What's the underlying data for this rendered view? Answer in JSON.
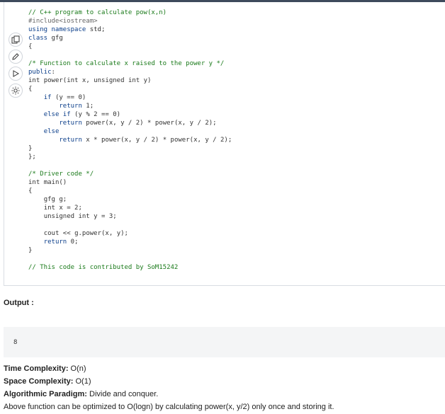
{
  "code": {
    "lines": [
      "// C++ program to calculate pow(x,n)",
      "#include<iostream>",
      "using namespace std;",
      "class gfg",
      "{",
      "",
      "/* Function to calculate x raised to the power y */",
      "public:",
      "int power(int x, unsigned int y)",
      "{",
      "    if (y == 0)",
      "        return 1;",
      "    else if (y % 2 == 0)",
      "        return power(x, y / 2) * power(x, y / 2);",
      "    else",
      "        return x * power(x, y / 2) * power(x, y / 2);",
      "}",
      "};",
      "",
      "/* Driver code */",
      "int main()",
      "{",
      "    gfg g;",
      "    int x = 2;",
      "    unsigned int y = 3;",
      "",
      "    cout << g.power(x, y);",
      "    return 0;",
      "}",
      "",
      "// This code is contributed by SoM15242"
    ]
  },
  "output": {
    "label": "Output :",
    "value": "8"
  },
  "complexity": {
    "time_label": "Time Complexity:",
    "time_value": " O(n)",
    "space_label": "Space Complexity:",
    "space_value": " O(1)",
    "paradigm_label": "Algorithmic Paradigm:",
    "paradigm_value": " Divide and conquer.",
    "note": "Above function can be optimized to O(logn) by calculating power(x, y/2) only once and storing it."
  },
  "icons": [
    "copy-icon",
    "edit-icon",
    "run-icon",
    "theme-icon"
  ]
}
